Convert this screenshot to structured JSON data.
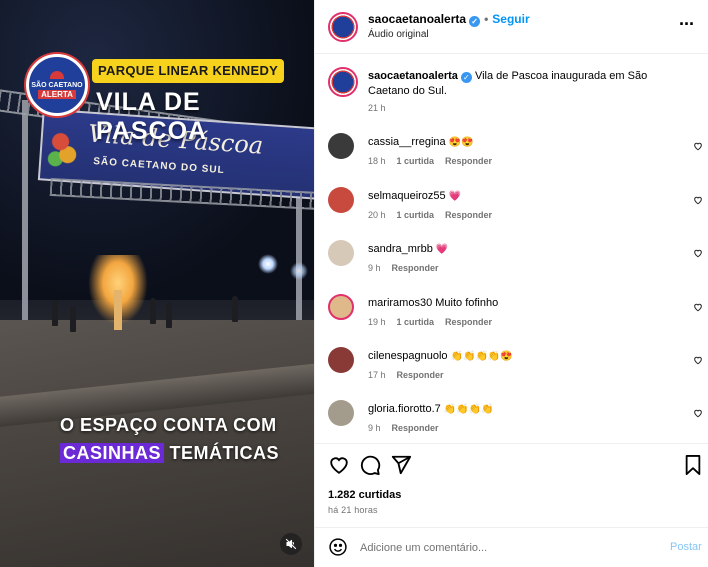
{
  "media": {
    "tag": "PARQUE LINEAR KENNEDY",
    "headline": "VILA DE PASCOA",
    "logo_top": "SÃO CAETANO",
    "logo_bottom": "ALERTA",
    "banner_title": "Vila de Páscoa",
    "banner_subtitle": "SÃO CAETANO DO SUL",
    "caption_line1": "O ESPAÇO CONTA COM",
    "caption_highlight": "CASINHAS",
    "caption_rest": " TEMÁTICAS",
    "mute_icon": "speaker-muted-icon"
  },
  "header": {
    "username": "saocaetanoalerta",
    "follow_label": "Seguir",
    "audio_label": "Áudio original",
    "more_icon": "more-horizontal-icon"
  },
  "caption": {
    "username": "saocaetanoalerta",
    "text": "Vila de Pascoa inaugurada em São Caetano do Sul.",
    "time": "21 h"
  },
  "comments": [
    {
      "username": "cassia__rregina",
      "text": "😍😍",
      "time": "18 h",
      "likes": "1 curtida",
      "reply": "Responder",
      "avatar_color": "#3a3a3a"
    },
    {
      "username": "selmaqueiroz55",
      "text": "💗",
      "time": "20 h",
      "likes": "1 curtida",
      "reply": "Responder",
      "avatar_color": "#c84a3f"
    },
    {
      "username": "sandra_mrbb",
      "text": "💗",
      "time": "9 h",
      "likes": "",
      "reply": "Responder",
      "avatar_color": "#d6c9b8"
    },
    {
      "username": "mariramos30",
      "text": "Muito fofinho",
      "time": "19 h",
      "likes": "1 curtida",
      "reply": "Responder",
      "avatar_color": "#e0b98a"
    },
    {
      "username": "cilenespagnuolo",
      "text": "👏👏👏👏😍",
      "time": "17 h",
      "likes": "",
      "reply": "Responder",
      "avatar_color": "#8a3a36"
    },
    {
      "username": "gloria.fiorotto.7",
      "text": "👏👏👏👏",
      "time": "9 h",
      "likes": "",
      "reply": "Responder",
      "avatar_color": "#a39b8c"
    }
  ],
  "actions": {
    "like_icon": "heart-icon",
    "comment_icon": "comment-icon",
    "share_icon": "send-icon",
    "save_icon": "bookmark-icon",
    "likes_count": "1.282 curtidas",
    "posted_time": "há 21 horas"
  },
  "composer": {
    "emoji_icon": "emoji-icon",
    "placeholder": "Adicione um comentário...",
    "post_label": "Postar"
  },
  "colors": {
    "accent": "#0095f6",
    "verified": "#3897f0",
    "highlight": "#6b2ad6",
    "tag_yellow": "#f6d21c"
  }
}
